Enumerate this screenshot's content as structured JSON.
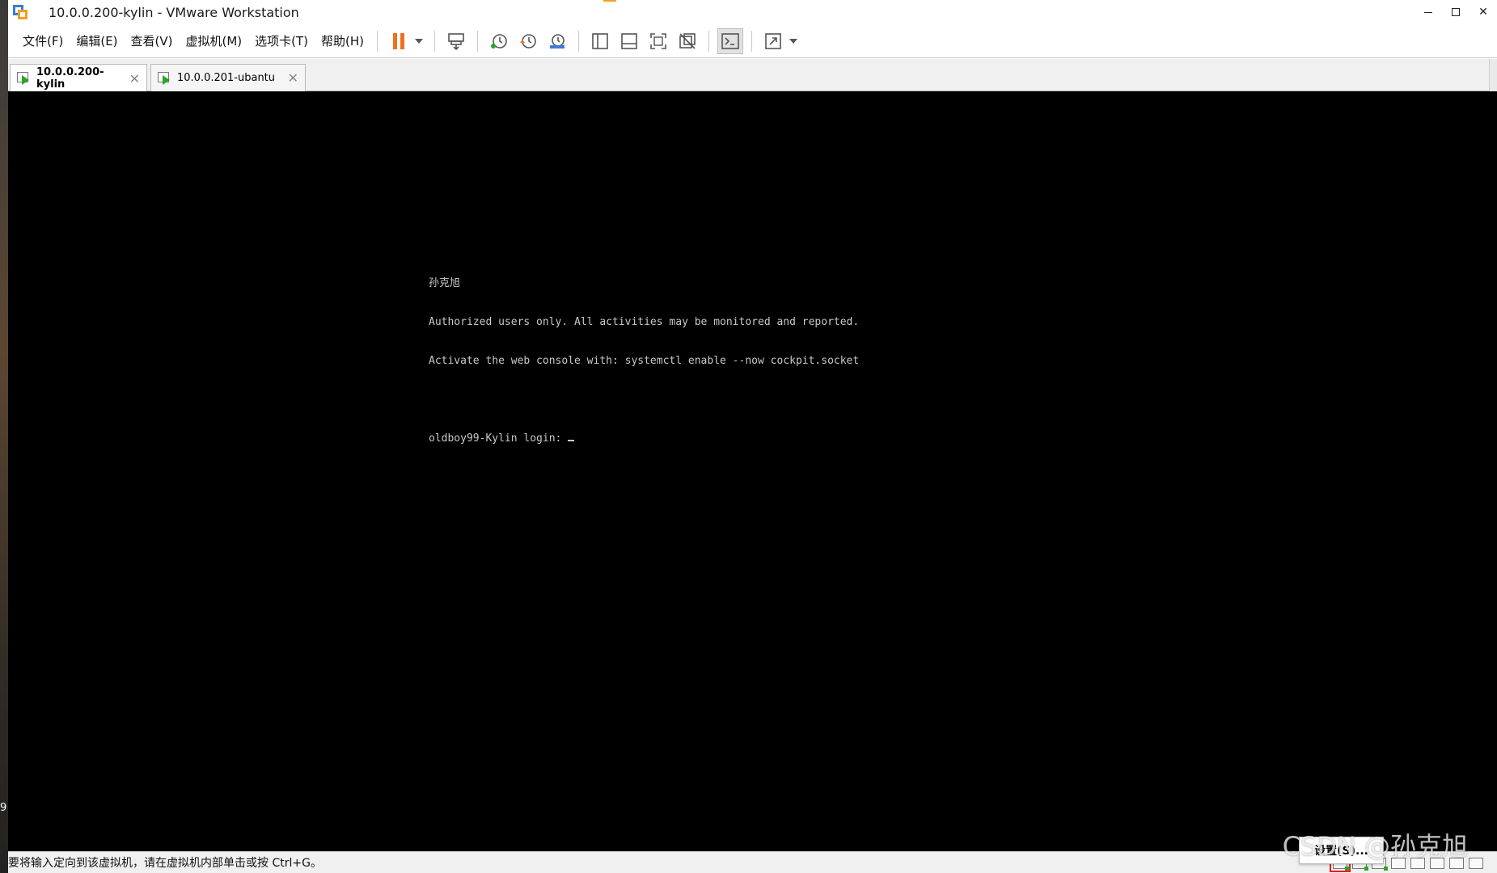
{
  "window": {
    "title": "10.0.0.200-kylin - VMware Workstation"
  },
  "desktop": {
    "edge_text": "9"
  },
  "menu": {
    "items": [
      "文件(F)",
      "编辑(E)",
      "查看(V)",
      "虚拟机(M)",
      "选项卡(T)",
      "帮助(H)"
    ]
  },
  "toolbar": {
    "icons": [
      "pause-icon",
      "send-ctrl-alt-del-icon",
      "snapshot-take-icon",
      "snapshot-revert-icon",
      "snapshot-manager-icon",
      "show-library-icon",
      "show-thumbnail-bar-icon",
      "full-screen-icon",
      "unity-icon",
      "console-view-icon",
      "stretch-guest-icon"
    ],
    "accent_color": "#f07020"
  },
  "tabs": [
    {
      "label": "10.0.0.200-kylin",
      "active": true
    },
    {
      "label": "10.0.0.201-ubantu",
      "active": false
    }
  ],
  "console": {
    "lines": [
      "孙克旭",
      "Authorized users only. All activities may be monitored and reported.",
      "Activate the web console with: systemctl enable --now cockpit.socket",
      "",
      "oldboy99-Kylin login: "
    ]
  },
  "statusbar": {
    "message": "要将输入定向到该虚拟机，请在虚拟机内部单击或按 Ctrl+G。",
    "popup": "设置(S)..."
  },
  "watermark": "CSDN @孙克旭"
}
